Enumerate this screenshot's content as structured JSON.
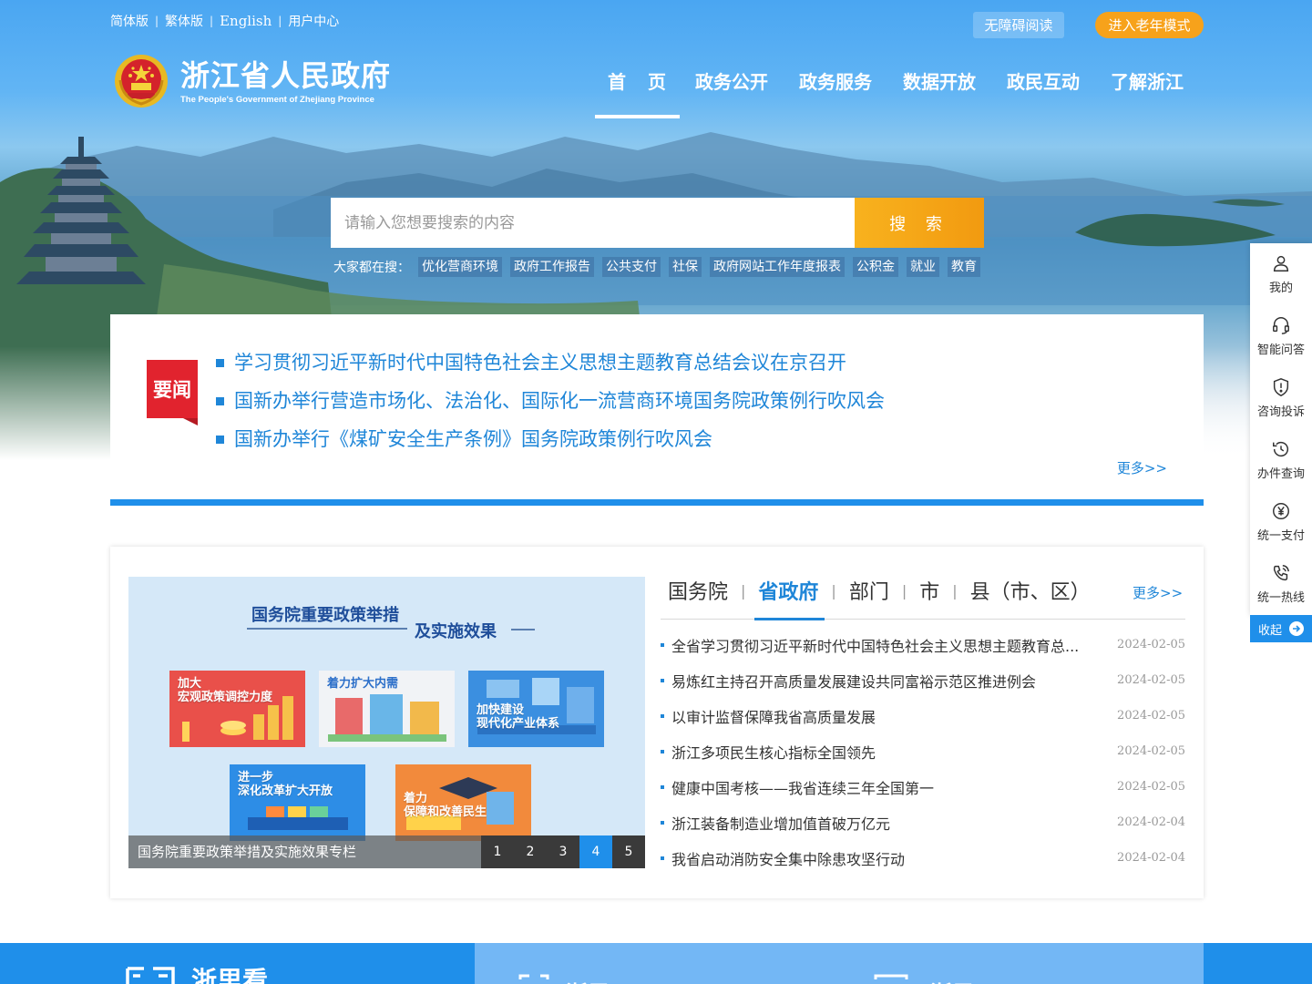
{
  "topbar": {
    "links": [
      "简体版",
      "繁体版",
      "English",
      "用户中心"
    ],
    "accessible_label": "无障碍阅读",
    "elder_label": "进入老年模式"
  },
  "logo": {
    "cn": "浙江省人民政府",
    "en": "The People's Government of Zhejiang Province"
  },
  "nav": {
    "items": [
      "首页",
      "政务公开",
      "政务服务",
      "数据开放",
      "政民互动",
      "了解浙江"
    ],
    "active": "首页"
  },
  "search": {
    "placeholder": "请输入您想要搜索的内容",
    "button": "搜 索",
    "hot_label": "大家都在搜：",
    "hot_tags": [
      "优化营商环境",
      "政府工作报告",
      "公共支付",
      "社保",
      "政府网站工作年度报表",
      "公积金",
      "就业",
      "教育"
    ]
  },
  "headlines": {
    "badge": "要闻",
    "items": [
      "学习贯彻习近平新时代中国特色社会主义思想主题教育总结会议在京召开",
      "国新办举行营造市场化、法治化、国际化一流营商环境国务院政策例行吹风会",
      "国新办举行《煤矿安全生产条例》国务院政策例行吹风会"
    ],
    "more": "更多>>"
  },
  "carousel": {
    "title_line1": "国务院重要政策举措",
    "title_line2": "及实施效果",
    "tiles": [
      {
        "text": "加大\n宏观政策调控力度",
        "color": "#e9504a"
      },
      {
        "text": "着力扩大内需",
        "color": "#f1f3f6"
      },
      {
        "text": "加快建设\n现代化产业体系",
        "color": "#3b8fe0"
      },
      {
        "text": "进一步\n深化改革扩大开放",
        "color": "#2d8de6"
      },
      {
        "text": "着力\n保障和改善民生",
        "color": "#f28a3c"
      }
    ],
    "caption": "国务院重要政策举措及实施效果专栏",
    "pages": [
      "1",
      "2",
      "3",
      "4",
      "5"
    ],
    "active_page": "4"
  },
  "news_tabs": {
    "tabs": [
      "国务院",
      "省政府",
      "部门",
      "市",
      "县（市、区）"
    ],
    "active": "省政府",
    "more": "更多>>"
  },
  "news_list": [
    {
      "title": "全省学习贯彻习近平新时代中国特色社会主义思想主题教育总...",
      "date": "2024-02-05"
    },
    {
      "title": "易炼红主持召开高质量发展建设共同富裕示范区推进例会",
      "date": "2024-02-05"
    },
    {
      "title": "以审计监督保障我省高质量发展",
      "date": "2024-02-05"
    },
    {
      "title": "浙江多项民生核心指标全国领先",
      "date": "2024-02-05"
    },
    {
      "title": "健康中国考核——我省连续三年全国第一",
      "date": "2024-02-05"
    },
    {
      "title": "浙江装备制造业增加值首破万亿元",
      "date": "2024-02-04"
    },
    {
      "title": "我省启动消防安全集中除患攻坚行动",
      "date": "2024-02-04"
    }
  ],
  "side_tools": [
    {
      "label": "我的",
      "icon": "user-icon"
    },
    {
      "label": "智能问答",
      "icon": "headset-icon"
    },
    {
      "label": "咨询投诉",
      "icon": "shield-alert-icon"
    },
    {
      "label": "办件查询",
      "icon": "history-icon"
    },
    {
      "label": "统一支付",
      "icon": "yen-icon"
    },
    {
      "label": "统一热线",
      "icon": "phone-icon"
    }
  ],
  "collapse_label": "收起",
  "footer_strip": {
    "left_title": "浙里看",
    "mid_title_1": "浙里",
    "mid_title_2": "浙里"
  },
  "colors": {
    "primary": "#1f8fea",
    "link": "#1f86d8",
    "accent_orange": "#f7a21b",
    "badge_red": "#e1232e"
  }
}
